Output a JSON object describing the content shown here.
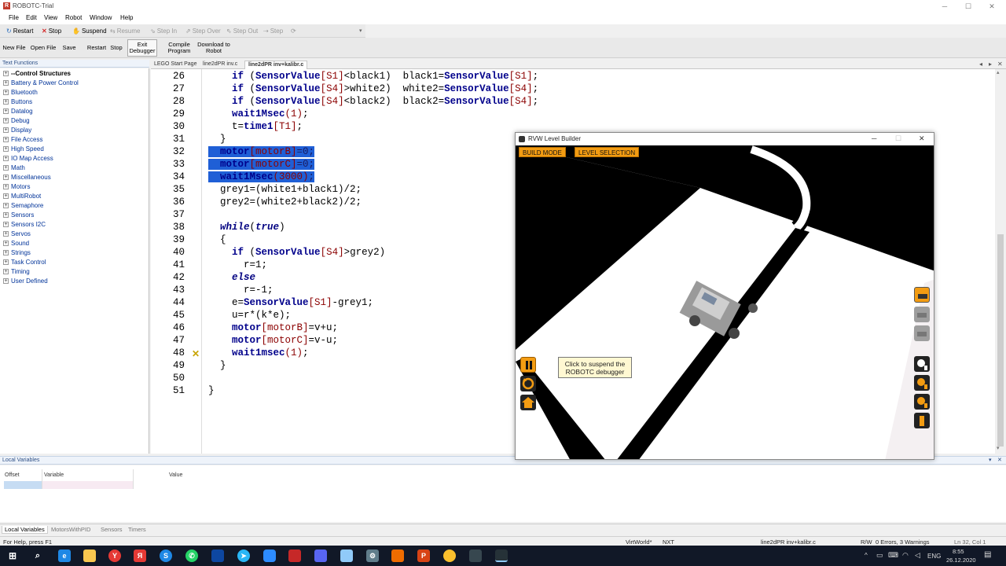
{
  "app": {
    "title": "ROBOTC-Trial",
    "icon_letter": "R"
  },
  "window_controls": {
    "minimize": "─",
    "maximize": "☐",
    "close": "✕"
  },
  "menu": [
    "File",
    "Edit",
    "View",
    "Robot",
    "Window",
    "Help"
  ],
  "toolbar_debug": [
    {
      "label": "Restart",
      "icon": "restart-icon",
      "enabled": true
    },
    {
      "label": "Stop",
      "icon": "stop-icon",
      "enabled": true
    },
    {
      "label": "Suspend",
      "icon": "suspend-icon",
      "enabled": true
    },
    {
      "label": "Resume",
      "icon": "resume-icon",
      "enabled": false
    },
    {
      "label": "Step In",
      "icon": "step-in-icon",
      "enabled": false
    },
    {
      "label": "Step Over",
      "icon": "step-over-icon",
      "enabled": false
    },
    {
      "label": "Step Out",
      "icon": "step-out-icon",
      "enabled": false
    },
    {
      "label": "Step",
      "icon": "step-icon",
      "enabled": false
    }
  ],
  "toolbar_main": [
    {
      "label": "New File"
    },
    {
      "label": "Open File"
    },
    {
      "label": "Save"
    },
    {
      "label": "Restart"
    },
    {
      "label": "Stop"
    },
    {
      "label": "Exit\nDebugger"
    },
    {
      "label": "Compile\nProgram"
    },
    {
      "label": "Download to\nRobot"
    }
  ],
  "left_panel": {
    "title": "Text Functions",
    "items": [
      "--Control Structures",
      "Battery & Power Control",
      "Bluetooth",
      "Buttons",
      "Datalog",
      "Debug",
      "Display",
      "File Access",
      "High Speed",
      "IO Map Access",
      "Math",
      "Miscellaneous",
      "Motors",
      "MultiRobot",
      "Semaphore",
      "Sensors",
      "Sensors I2C",
      "Servos",
      "Sound",
      "Strings",
      "Task Control",
      "Timing",
      "User Defined"
    ]
  },
  "tabs": [
    {
      "label": "LEGO Start Page",
      "active": false
    },
    {
      "label": "line2dPR inv.c",
      "active": false
    },
    {
      "label": "line2dPR inv+kalibr.c",
      "active": true
    }
  ],
  "code_lines": [
    {
      "num": "26",
      "code": "    if (SensorValue[S1]<black1)  black1=SensorValue[S1];"
    },
    {
      "num": "27",
      "code": "    if (SensorValue[S4]>white2)  white2=SensorValue[S4];"
    },
    {
      "num": "28",
      "code": "    if (SensorValue[S4]<black2)  black2=SensorValue[S4];"
    },
    {
      "num": "29",
      "code": "    wait1Msec(1);"
    },
    {
      "num": "30",
      "code": "    t=time1[T1];"
    },
    {
      "num": "31",
      "code": "  }"
    },
    {
      "num": "32",
      "code": "  motor[motorB]=0;"
    },
    {
      "num": "33",
      "code": "  motor[motorC]=0;"
    },
    {
      "num": "34",
      "code": "  wait1Msec(3000);"
    },
    {
      "num": "35",
      "code": "  grey1=(white1+black1)/2;"
    },
    {
      "num": "36",
      "code": "  grey2=(white2+black2)/2;"
    },
    {
      "num": "37",
      "code": ""
    },
    {
      "num": "38",
      "code": "  while(true)"
    },
    {
      "num": "39",
      "code": "  {"
    },
    {
      "num": "40",
      "code": "    if (SensorValue[S4]>grey2)"
    },
    {
      "num": "41",
      "code": "      r=1;"
    },
    {
      "num": "42",
      "code": "    else"
    },
    {
      "num": "43",
      "code": "      r=-1;"
    },
    {
      "num": "44",
      "code": "    e=SensorValue[S1]-grey1;"
    },
    {
      "num": "45",
      "code": "    u=r*(k*e);"
    },
    {
      "num": "46",
      "code": "    motor[motorB]=v+u;"
    },
    {
      "num": "47",
      "code": "    motor[motorC]=v-u;"
    },
    {
      "num": "48",
      "code": "    wait1msec(1);"
    },
    {
      "num": "49",
      "code": "  }"
    },
    {
      "num": "50",
      "code": ""
    },
    {
      "num": "51",
      "code": "}"
    }
  ],
  "local_variables": {
    "title": "Local Variables",
    "columns": [
      "Offset",
      "Variable",
      "Value"
    ]
  },
  "bottom_tabs": [
    "Local Variables",
    "MotorsWithPID",
    "Sensors",
    "Timers"
  ],
  "status": {
    "help": "For Help, press F1",
    "platform": "VirtWorld*",
    "target": "NXT",
    "file": "line2dPR inv+kalibr.c",
    "mode": "R/W",
    "errors": "0 Errors, 3 Warnings",
    "position": "Ln 32, Col 1"
  },
  "rvw": {
    "title": "RVW Level Builder",
    "modes": [
      "BUILD MODE",
      "LEVEL SELECTION"
    ],
    "tooltip": "Click to suspend the ROBOTC debugger"
  },
  "taskbar": {
    "tray_language": "ENG",
    "time": "8:55",
    "date": "26.12.2020"
  },
  "colors": {
    "accent": "#f39c12",
    "selection": "#1f5fd6",
    "taskbar": "#111827"
  }
}
